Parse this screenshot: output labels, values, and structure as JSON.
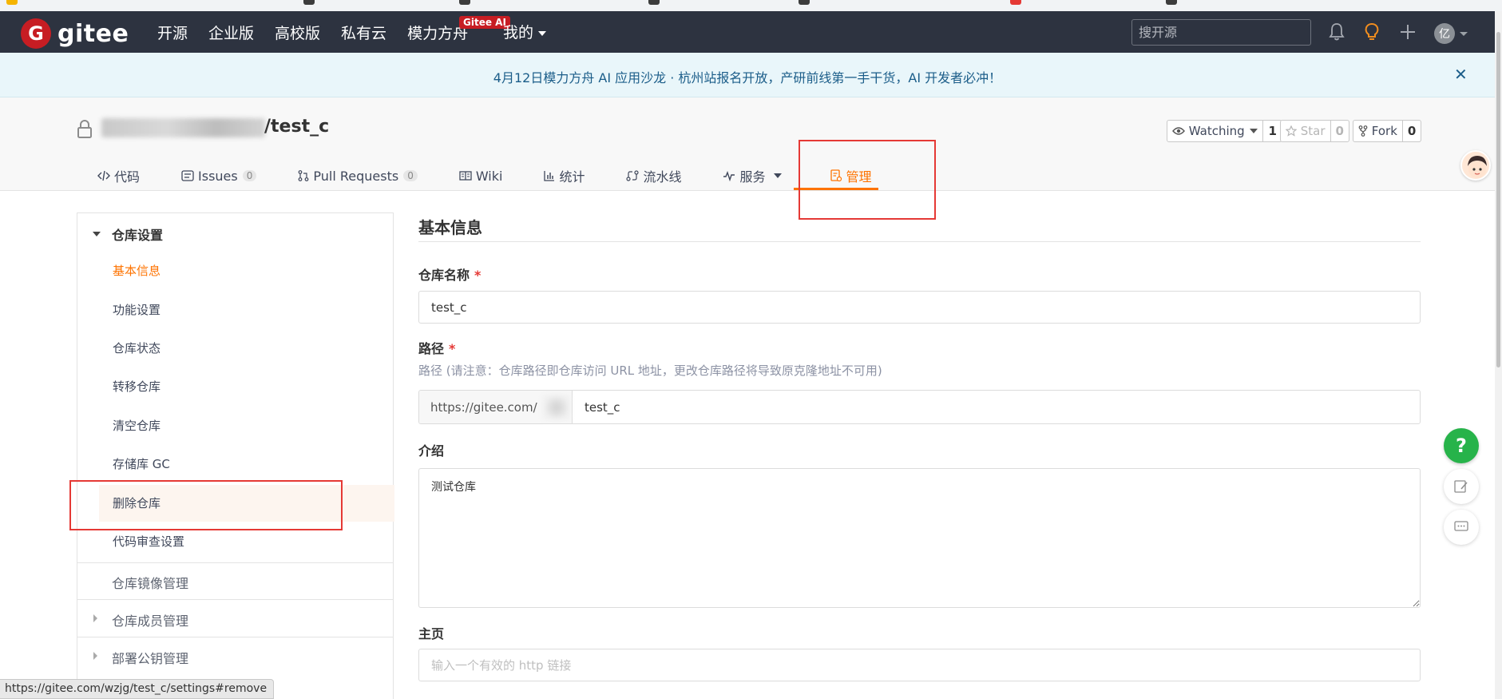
{
  "navbar": {
    "logo_text": "gitee",
    "logo_mark": "G",
    "links": [
      "开源",
      "企业版",
      "高校版",
      "私有云",
      "模力方舟"
    ],
    "ai_badge": "Gitee AI",
    "mine": "我的",
    "search_placeholder": "搜开源",
    "avatar_initial": "亿"
  },
  "announcement": {
    "text": "4月12日模力方舟 AI 应用沙龙 · 杭州站报名开放，产研前线第一手干货，AI 开发者必冲！",
    "close": "✕"
  },
  "repo": {
    "name": "/test_c",
    "watch_label": "Watching",
    "watch_count": "1",
    "star_label": "Star",
    "star_count": "0",
    "fork_label": "Fork",
    "fork_count": "0"
  },
  "tabs": [
    {
      "label": "代码"
    },
    {
      "label": "Issues",
      "count": "0"
    },
    {
      "label": "Pull Requests",
      "count": "0"
    },
    {
      "label": "Wiki"
    },
    {
      "label": "统计"
    },
    {
      "label": "流水线"
    },
    {
      "label": "服务"
    },
    {
      "label": "管理"
    }
  ],
  "sidebar": {
    "section_title": "仓库设置",
    "items": [
      "基本信息",
      "功能设置",
      "仓库状态",
      "转移仓库",
      "清空仓库",
      "存储库 GC",
      "删除仓库",
      "代码审查设置"
    ],
    "groups": [
      "仓库镜像管理",
      "仓库成员管理",
      "部署公钥管理"
    ]
  },
  "form": {
    "title": "基本信息",
    "name_label": "仓库名称",
    "name_value": "test_c",
    "path_label": "路径",
    "required_mark": "*",
    "path_hint": "路径 (请注意：仓库路径即仓库访问 URL 地址，更改仓库路径将导致原克隆地址不可用)",
    "path_prefix": "https://gitee.com/",
    "path_value": "test_c",
    "intro_label": "介绍",
    "intro_value": "测试仓库",
    "homepage_label": "主页",
    "homepage_placeholder": "输入一个有效的 http 链接"
  },
  "floating": {
    "help": "?"
  },
  "status_bar": {
    "url": "https://gitee.com/wzjg/test_c/settings#remove"
  },
  "colors": {
    "navbar_bg": "#2d3340",
    "accent": "#fe7300",
    "brand_red": "#c71d23",
    "highlight_box": "#e53935",
    "help_green": "#27b34a"
  }
}
